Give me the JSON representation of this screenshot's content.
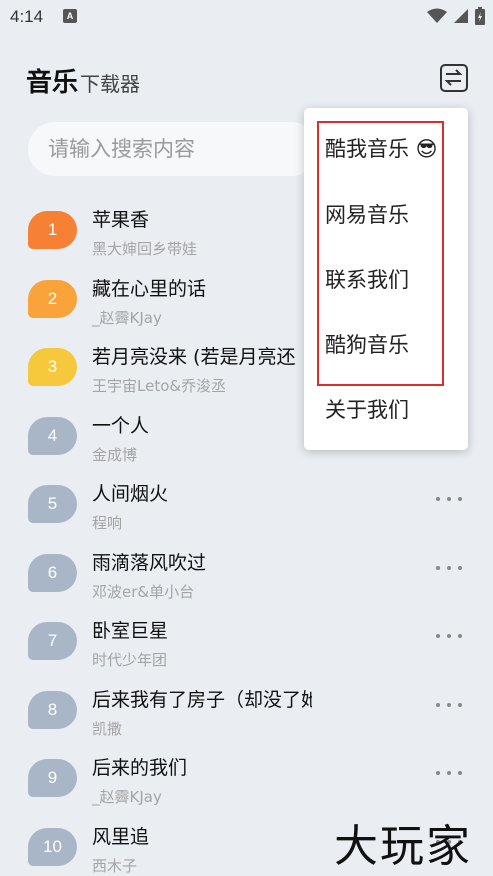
{
  "status_bar": {
    "time": "4:14",
    "notif_icon": "A"
  },
  "header": {
    "title": "音乐",
    "subtitle": "下载器",
    "switch_icon": "swap-arrows-icon"
  },
  "search": {
    "placeholder": "请输入搜索内容",
    "value": ""
  },
  "songs": [
    {
      "rank": "1",
      "title": "苹果香",
      "artist": "黑大婶回乡带娃",
      "color": "#f68033"
    },
    {
      "rank": "2",
      "title": "藏在心里的话",
      "artist": "_赵霽KJay",
      "color": "#f9a43a"
    },
    {
      "rank": "3",
      "title": "若月亮没来 (若是月亮还",
      "artist": "王宇宙Leto&乔浚丞",
      "color": "#f6c93c"
    },
    {
      "rank": "4",
      "title": "一个人",
      "artist": "金成博",
      "color": "#a9b6c7"
    },
    {
      "rank": "5",
      "title": "人间烟火",
      "artist": "程响",
      "color": "#a9b6c7"
    },
    {
      "rank": "6",
      "title": "雨滴落风吹过",
      "artist": "邓波er&单小台",
      "color": "#a9b6c7"
    },
    {
      "rank": "7",
      "title": "卧室巨星",
      "artist": "时代少年团",
      "color": "#a9b6c7"
    },
    {
      "rank": "8",
      "title": "后来我有了房子（却没了她）",
      "artist": "凯撒",
      "color": "#a9b6c7"
    },
    {
      "rank": "9",
      "title": "后来的我们",
      "artist": "_赵霽KJay",
      "color": "#a9b6c7"
    },
    {
      "rank": "10",
      "title": "风里追",
      "artist": "西木子",
      "color": "#a9b6c7"
    }
  ],
  "menu": {
    "items": [
      "酷我音乐 😎",
      "网易音乐",
      "联系我们",
      "酷狗音乐",
      "关于我们"
    ],
    "highlight_color": "#d9302c"
  },
  "watermark": "大玩家"
}
